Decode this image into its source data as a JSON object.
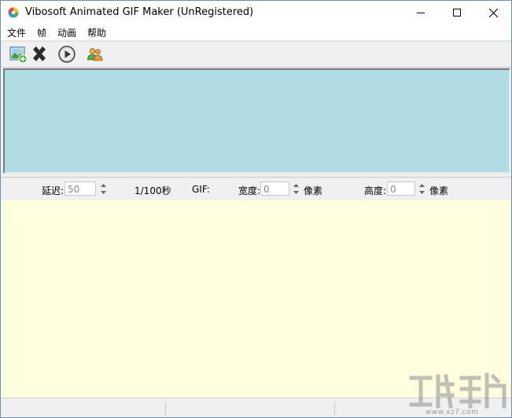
{
  "window": {
    "title": "Vibosoft Animated GIF Maker (UnRegistered)"
  },
  "menu": {
    "items": [
      "文件",
      "帧",
      "动画",
      "帮助"
    ]
  },
  "toolbar": {
    "tools": [
      "add-frame-icon",
      "delete-icon",
      "play-icon",
      "people-icon"
    ]
  },
  "settings": {
    "delay_label": "延迟:",
    "delay_value": "50",
    "delay_unit": "1/100秒",
    "gif_label": "GIF:",
    "width_label": "宽度:",
    "width_value": "0",
    "width_unit": "像素",
    "height_label": "高度:",
    "height_value": "0",
    "height_unit": "像素"
  },
  "colors": {
    "frames_panel_bg": "#b0dde3",
    "preview_bg": "#ffffe0",
    "window_chrome": "#f0f0f0"
  },
  "watermark": {
    "url": "www.xz7.com"
  }
}
